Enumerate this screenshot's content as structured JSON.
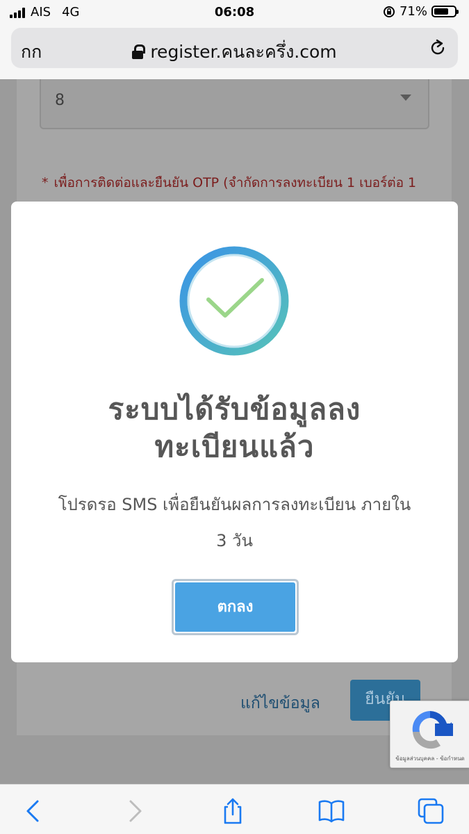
{
  "status_bar": {
    "carrier": "AIS",
    "network": "4G",
    "time": "06:08",
    "battery": "71%",
    "battery_level": 0.71
  },
  "address_bar": {
    "text_size_label": "กก",
    "url": "register.คนละครึ่ง.com",
    "icons": [
      "lock-icon",
      "reload-icon"
    ]
  },
  "page": {
    "select_value": "8",
    "note_star": "*",
    "note_text": "เพื่อการติดต่อและยืนยัน OTP (จำกัดการลงทะเบียน 1 เบอร์ต่อ 1",
    "edit_label": "แก้ไขข้อมูล",
    "confirm_label": "ยืนยัน"
  },
  "modal": {
    "title_line1": "ระบบได้รับข้อมูลลง",
    "title_line2": "ทะเบียนแล้ว",
    "message_line1": "โปรดรอ SMS เพื่อยืนยันผลการลงทะเบียน ภายใน",
    "message_line2": "3 วัน",
    "ok_label": "ตกลง",
    "icon": "success-check-icon"
  },
  "recaptcha": {
    "text": "ข้อมูลส่วนบุคคล - ข้อกำหนด"
  },
  "toolbar": {
    "icons": [
      "back-icon",
      "forward-icon",
      "share-icon",
      "bookmarks-icon",
      "tabs-icon"
    ]
  },
  "colors": {
    "ok_button": "#4aa3e3",
    "check_ring": "#4aa3e3",
    "check_mark": "#9bd68a",
    "note_text": "#7b1d1d",
    "title_text": "#575757"
  }
}
